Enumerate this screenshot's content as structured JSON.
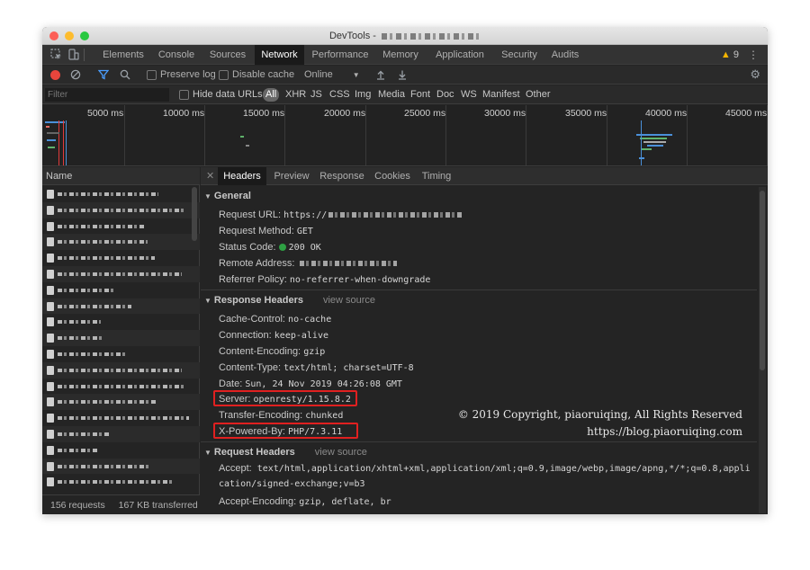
{
  "window": {
    "title": "DevTools - "
  },
  "tabs": [
    "Elements",
    "Console",
    "Sources",
    "Network",
    "Performance",
    "Memory",
    "Application",
    "Security",
    "Audits"
  ],
  "active_tab": "Network",
  "warnings": {
    "count": "9"
  },
  "controls": {
    "preserve_log": "Preserve log",
    "disable_cache": "Disable cache",
    "throttle": "Online"
  },
  "filter": {
    "placeholder": "Filter",
    "hide_data_urls": "Hide data URLs",
    "types": [
      "All",
      "XHR",
      "JS",
      "CSS",
      "Img",
      "Media",
      "Font",
      "Doc",
      "WS",
      "Manifest",
      "Other"
    ],
    "active_type": "All"
  },
  "timeline": {
    "ticks": [
      "5000 ms",
      "10000 ms",
      "15000 ms",
      "20000 ms",
      "25000 ms",
      "30000 ms",
      "35000 ms",
      "40000 ms",
      "45000 ms"
    ]
  },
  "requests": {
    "header": "Name",
    "summary": "156 requests",
    "transferred": "167 KB transferred"
  },
  "detail_tabs": [
    "Headers",
    "Preview",
    "Response",
    "Cookies",
    "Timing"
  ],
  "active_detail_tab": "Headers",
  "general": {
    "title": "General",
    "request_url_key": "Request URL:",
    "request_url_val": "https://",
    "request_method_key": "Request Method:",
    "request_method_val": "GET",
    "status_code_key": "Status Code:",
    "status_code_val": "200 OK",
    "remote_address_key": "Remote Address:",
    "referrer_policy_key": "Referrer Policy:",
    "referrer_policy_val": "no-referrer-when-downgrade"
  },
  "response_headers": {
    "title": "Response Headers",
    "view_source": "view source",
    "rows": [
      {
        "key": "Cache-Control:",
        "val": "no-cache"
      },
      {
        "key": "Connection:",
        "val": "keep-alive"
      },
      {
        "key": "Content-Encoding:",
        "val": "gzip"
      },
      {
        "key": "Content-Type:",
        "val": "text/html; charset=UTF-8"
      },
      {
        "key": "Date:",
        "val": "Sun, 24 Nov 2019 04:26:08 GMT"
      },
      {
        "key": "Server:",
        "val": "openresty/1.15.8.2"
      },
      {
        "key": "Transfer-Encoding:",
        "val": "chunked"
      },
      {
        "key": "X-Powered-By:",
        "val": "PHP/7.3.11"
      }
    ]
  },
  "request_headers": {
    "title": "Request Headers",
    "view_source": "view source",
    "accept_key": "Accept:",
    "accept_val": "text/html,application/xhtml+xml,application/xml;q=0.9,image/webp,image/apng,*/*;q=0.8,application/signed-exchange;v=b3",
    "accept_encoding_key": "Accept-Encoding:",
    "accept_encoding_val": "gzip, deflate, br"
  },
  "watermark": {
    "line1": "© 2019 Copyright, piaoruiqing, All Rights Reserved",
    "line2": "https://blog.piaoruiqing.com"
  },
  "colors": {
    "accent": "#1a73e8",
    "record": "#e8453c",
    "status_ok": "#2ea043",
    "highlight": "#e02020"
  },
  "icons": [
    "inspect-icon",
    "device-icon",
    "record-icon",
    "clear-icon",
    "filter-icon",
    "search-icon",
    "import-icon",
    "export-icon",
    "gear-icon",
    "warning-icon",
    "more-icon",
    "close-icon",
    "file-icon"
  ]
}
